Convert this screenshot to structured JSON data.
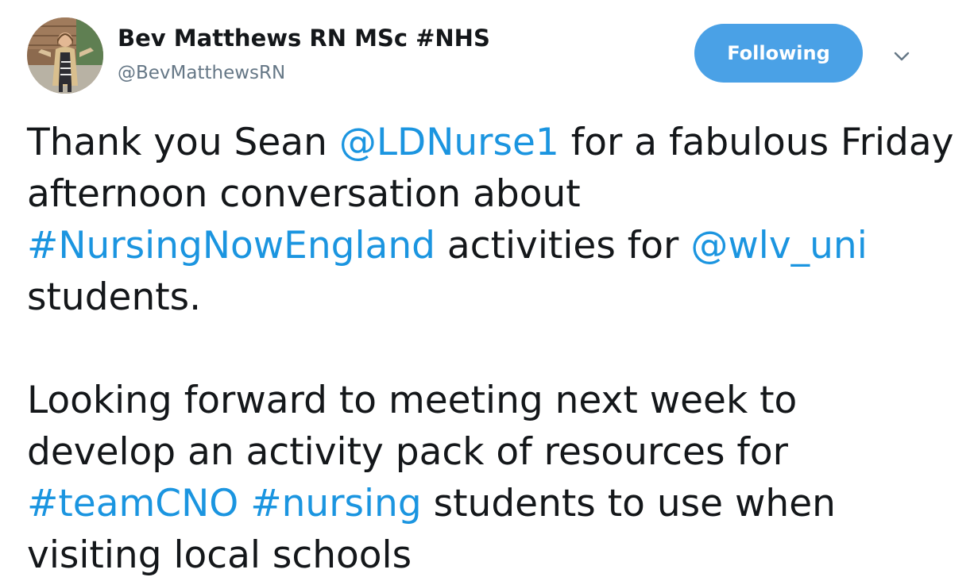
{
  "author": {
    "display_name": "Bev Matthews RN MSc #NHS",
    "handle": "@BevMatthewsRN",
    "avatar_icon": "profile-photo"
  },
  "follow_button": {
    "label": "Following",
    "color": "#4aa1e6"
  },
  "menu": {
    "icon": "chevron-down-icon"
  },
  "tweet": {
    "p1_t1": "Thank you Sean ",
    "p1_mention1": "@LDNurse1",
    "p1_t2": " for a fabulous Friday afternoon conversation about ",
    "p1_hashtag1": "#NursingNowEngland",
    "p1_t3": " activities for ",
    "p1_mention2": "@wlv_uni",
    "p1_t4": " students.",
    "p2_t1": "Looking forward to meeting next week to develop an activity pack of resources for ",
    "p2_hashtag1": "#teamCNO",
    "p2_t2": " ",
    "p2_hashtag2": "#nursing",
    "p2_t3": " students to use when visiting local schools"
  },
  "colors": {
    "text": "#14171a",
    "secondary": "#657786",
    "link": "#1b95e0"
  }
}
